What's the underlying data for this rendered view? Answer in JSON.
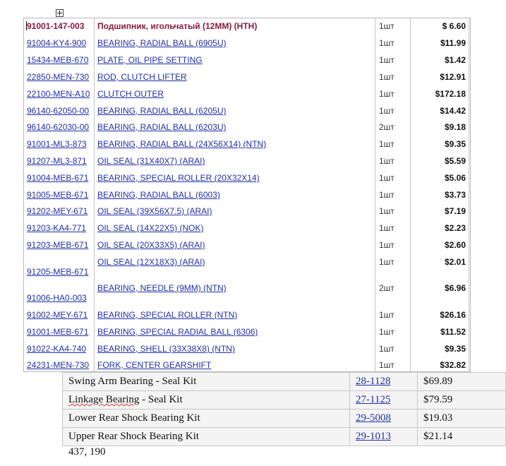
{
  "parts": [
    {
      "pn": "91001-147-003",
      "desc": "Подшипник, игольчатый (12MM) (HTH)",
      "qty": "1шт",
      "price": "$ 6.60"
    },
    {
      "pn": "91004-KY4-900",
      "desc": "BEARING, RADIAL BALL (6905U)",
      "qty": "1шт",
      "price": "$11.99"
    },
    {
      "pn": "15434-MEB-670",
      "desc": "PLATE, OIL PIPE SETTING",
      "qty": "1шт",
      "price": "$1.42"
    },
    {
      "pn": "22850-MEN-730",
      "desc": "ROD, CLUTCH LIFTER",
      "qty": "1шт",
      "price": "$12.91"
    },
    {
      "pn": "22100-MEN-A10",
      "desc": "CLUTCH OUTER",
      "qty": "1шт",
      "price": "$172.18"
    },
    {
      "pn": "96140-62050-00",
      "desc": "BEARING, RADIAL BALL (6205U)",
      "qty": "1шт",
      "price": "$14.42"
    },
    {
      "pn": "96140-62030-00",
      "desc": "BEARING, RADIAL BALL (6203U)",
      "qty": "2шт",
      "price": "$9.18"
    },
    {
      "pn": "91001-ML3-873",
      "desc": "BEARING, RADIAL BALL (24X56X14) (NTN)",
      "qty": "1шт",
      "price": "$9.35"
    },
    {
      "pn": "91207-ML3-871",
      "desc": "OIL SEAL (31X40X7) (ARAI)",
      "qty": "1шт",
      "price": "$5.59"
    },
    {
      "pn": "91004-MEB-671",
      "desc": "BEARING, SPECIAL ROLLER (20X32X14)",
      "qty": "1шт",
      "price": "$5.06"
    },
    {
      "pn": "91005-MEB-671",
      "desc": "BEARING, RADIAL BALL (6003)",
      "qty": "1шт",
      "price": "$3.73"
    },
    {
      "pn": "91202-MEY-671",
      "desc": "OIL SEAL (39X56X7.5) (ARAI)",
      "qty": "1шт",
      "price": "$7.19"
    },
    {
      "pn": "91203-KA4-771",
      "desc": "OIL SEAL (14X22X5) (NOK)",
      "qty": "1шт",
      "price": "$2.23"
    },
    {
      "pn": "91203-MEB-671",
      "desc": "OIL SEAL (20X33X5) (ARAI)",
      "qty": "1шт",
      "price": "$2.60"
    },
    {
      "pn": "91205-MEB-671",
      "desc": "OIL SEAL (12X18X3) (ARAI)",
      "qty": "1шт",
      "price": "$2.01"
    },
    {
      "pn": "91006-HA0-003",
      "desc": "BEARING, NEEDLE (9MM) (NTN)",
      "qty": "2шт",
      "price": "$6.96"
    },
    {
      "pn": "91002-MEY-671",
      "desc": "BEARING, SPECIAL ROLLER (NTN)",
      "qty": "1шт",
      "price": "$26.16"
    },
    {
      "pn": "91001-MEB-671",
      "desc": "BEARING, SPECIAL RADIAL BALL (6306)",
      "qty": "1шт",
      "price": "$11.52"
    },
    {
      "pn": "91022-KA4-740",
      "desc": "BEARING, SHELL (33X38X8) (NTN)",
      "qty": "1шт",
      "price": "$9.35"
    },
    {
      "pn": "24231-MEN-730",
      "desc": "FORK, CENTER GEARSHIFT",
      "qty": "1шт",
      "price": "$32.82"
    }
  ],
  "kits": [
    {
      "name": "Swing Arm Bearing - Seal Kit",
      "pn": "28-1128",
      "price": "$69.89"
    },
    {
      "name_part1": "Linkage Bearing",
      "name_part2": " - Seal Kit",
      "pn": "27-1125",
      "price": "$79.59"
    },
    {
      "name": "Lower Rear Shock Bearing Kit",
      "pn": "29-5008",
      "price": "$19.03"
    },
    {
      "name": "Upper Rear Shock Bearing Kit",
      "pn": "29-1013",
      "price": "$21.14"
    }
  ],
  "coords_text": "437, 190"
}
